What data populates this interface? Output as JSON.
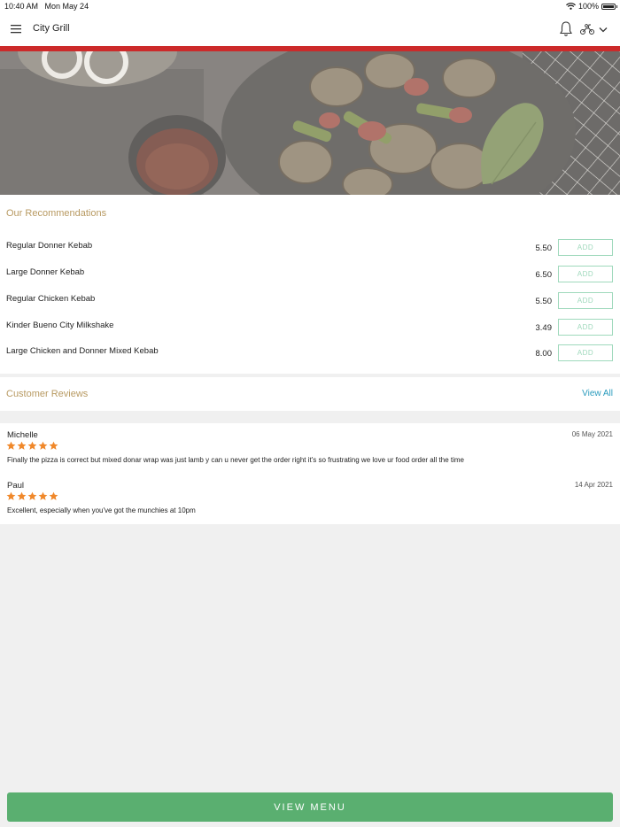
{
  "status_bar": {
    "time": "10:40 AM",
    "date": "Mon May 24",
    "battery": "100%",
    "battery_level": 1.0
  },
  "header": {
    "title": "City Grill",
    "menu_icon": "hamburger-menu-icon",
    "bell_icon": "bell-icon",
    "delivery_icon": "scooter-icon",
    "dropdown_icon": "chevron-down-icon"
  },
  "recommendations": {
    "title": "Our Recommendations",
    "items": [
      {
        "name": "Regular Donner Kebab",
        "price": "5.50",
        "action": "ADD"
      },
      {
        "name": "Large Donner Kebab",
        "price": "6.50",
        "action": "ADD"
      },
      {
        "name": "Regular Chicken Kebab",
        "price": "5.50",
        "action": "ADD"
      },
      {
        "name": "Kinder Bueno City Milkshake",
        "price": "3.49",
        "action": "ADD"
      },
      {
        "name": "Large Chicken and Donner Mixed Kebab",
        "price": "8.00",
        "action": "ADD"
      }
    ]
  },
  "reviews": {
    "title": "Customer Reviews",
    "view_all": "View All",
    "items": [
      {
        "name": "Michelle",
        "date": "06 May 2021",
        "rating": 5,
        "text": "Finally the pizza is correct but mixed donar wrap was just lamb y can u never get the order right it's so frustrating we love ur food order all the time"
      },
      {
        "name": "Paul",
        "date": "14 Apr 2021",
        "rating": 5,
        "text": "Excellent, especially when you've got the munchies at 10pm"
      }
    ]
  },
  "footer": {
    "view_menu": "VIEW MENU"
  },
  "colors": {
    "accent_gold": "#b89a62",
    "brand_red": "#cc2a2a",
    "button_green": "#5aaf70",
    "add_border": "#9fd9bc",
    "link_blue": "#2a9bbd",
    "star_orange": "#f0882a"
  }
}
